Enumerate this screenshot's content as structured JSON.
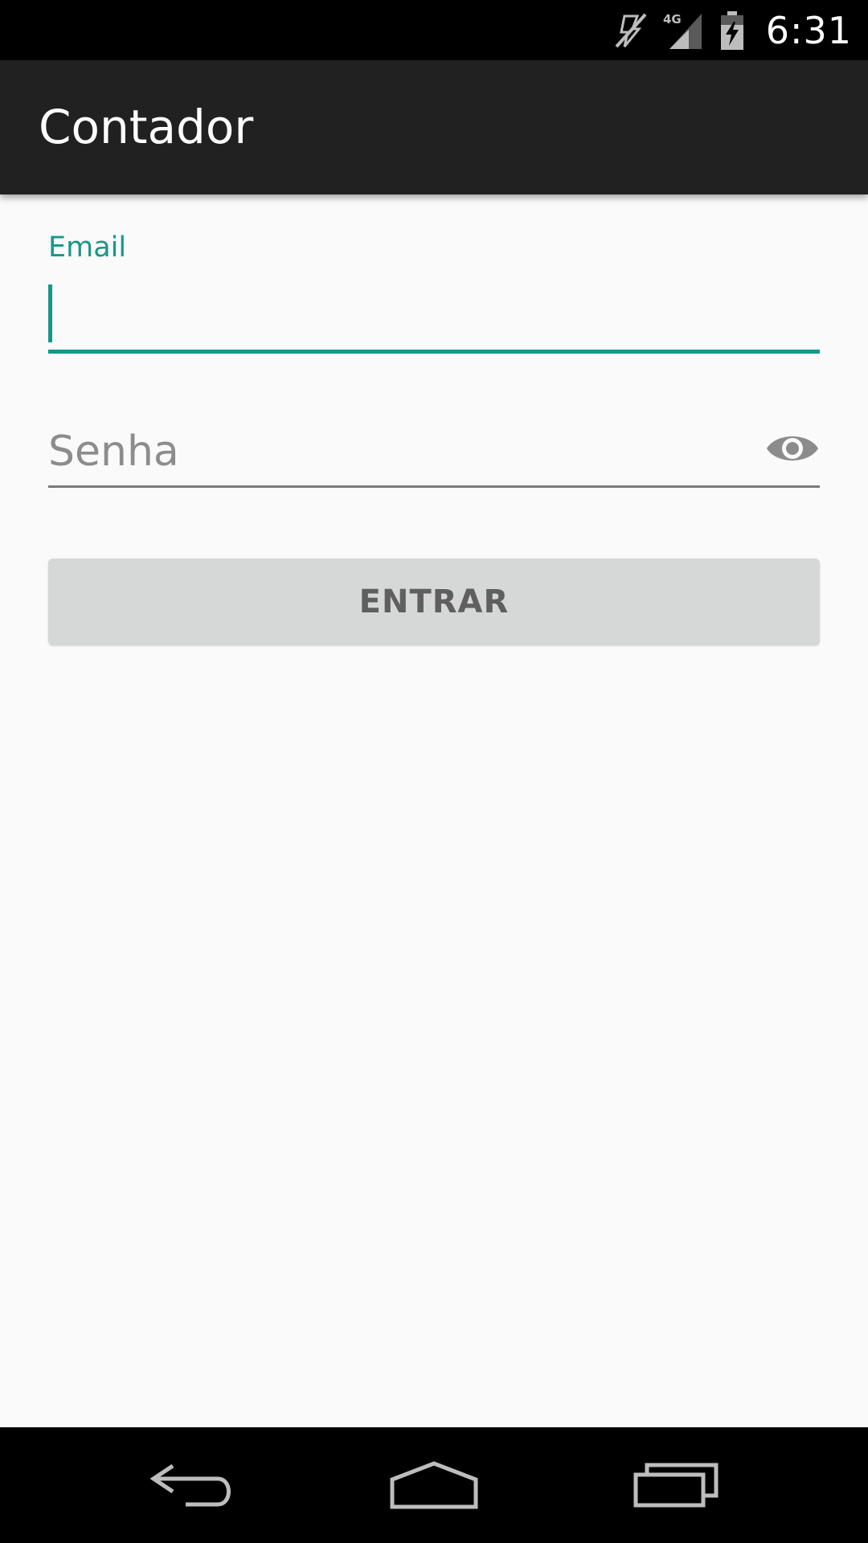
{
  "status_bar": {
    "time": "6:31",
    "network": "4G",
    "icons": [
      "vibrate-muted-icon",
      "signal-4g-icon",
      "battery-charging-icon"
    ]
  },
  "app_bar": {
    "title": "Contador"
  },
  "form": {
    "email": {
      "label": "Email",
      "value": ""
    },
    "password": {
      "placeholder": "Senha",
      "toggle_icon": "eye-icon"
    },
    "submit_label": "ENTRAR"
  },
  "nav_bar": {
    "icons": [
      "back-icon",
      "home-icon",
      "recents-icon"
    ]
  },
  "colors": {
    "accent": "#1a9688",
    "app_bar": "#212121",
    "background": "#fafafa",
    "button_disabled": "#d6d7d7"
  }
}
